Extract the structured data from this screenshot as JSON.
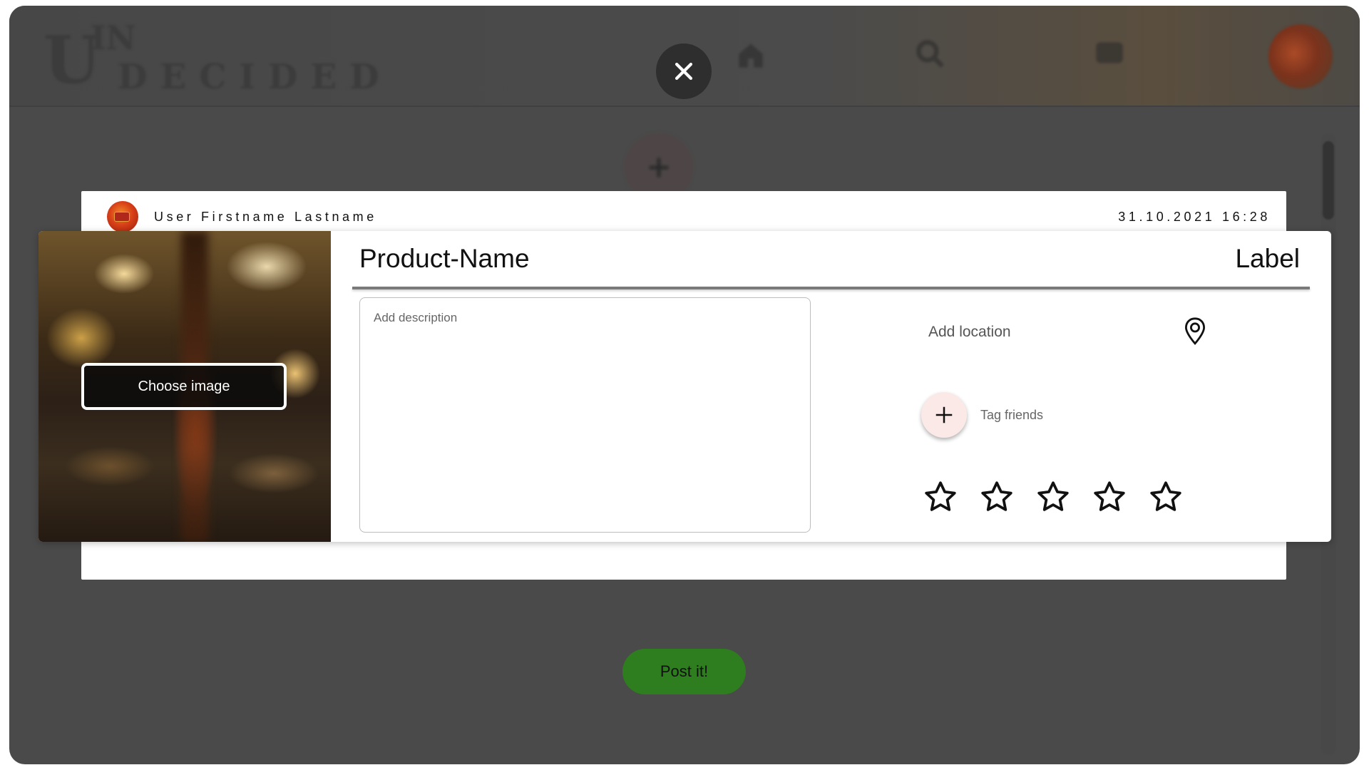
{
  "app": {
    "logo_small": "IN",
    "logo_big": "U",
    "logo_rest": "DECIDED"
  },
  "header": {
    "icons": [
      "home-icon",
      "search-icon",
      "chat-icon"
    ]
  },
  "modal": {
    "close_icon": "close-icon",
    "user": {
      "name": "User Firstname Lastname"
    },
    "timestamp": "31.10.2021 16:28",
    "product_name": "Product-Name",
    "label": "Label",
    "choose_image_label": "Choose image",
    "description": {
      "placeholder": "Add description",
      "value": ""
    },
    "location": {
      "placeholder": "Add location",
      "icon": "location-pin-icon"
    },
    "tag_friends_label": "Tag friends",
    "rating": {
      "value": 0,
      "max": 5
    },
    "post_button_label": "Post it!"
  },
  "colors": {
    "overlay": "#4a4a4a",
    "post_button": "#2e7d1e",
    "tag_button": "#fbe9e7",
    "close_button": "#2e2e2e"
  }
}
